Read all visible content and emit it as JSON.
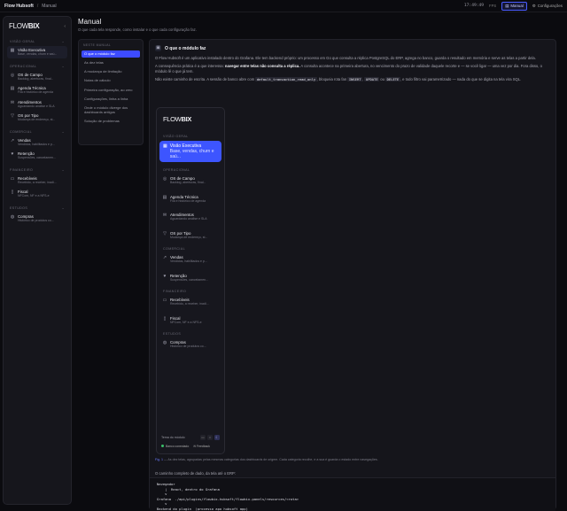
{
  "topbar": {
    "brand": "Flow Hubsoft",
    "breadcrumb": "Manual",
    "clock": "17:49:49",
    "fps": "FPS",
    "manual_label": "Manual",
    "config_label": "Configurações"
  },
  "sidebar": {
    "logo_flow": "FLOW",
    "logo_bix": "BIX",
    "sections": [
      {
        "title": "VISÃO GERAL",
        "items": [
          {
            "label": "Visão Executiva",
            "sub": "Base, vendas, churn e saú..."
          }
        ]
      },
      {
        "title": "OPERACIONAL",
        "items": [
          {
            "label": "OS de Campo",
            "sub": "Backlog, aberturas, final..."
          },
          {
            "label": "Agenda Técnica",
            "sub": "Fila e histórico de agenda"
          },
          {
            "label": "Atendimentos",
            "sub": "Aguardando análise e SLA"
          },
          {
            "label": "OS por Tipo",
            "sub": "Mudança de endereço, st..."
          }
        ]
      },
      {
        "title": "COMERCIAL",
        "items": [
          {
            "label": "Vendas",
            "sub": "Vendidos, habilitados e p..."
          },
          {
            "label": "Retenção",
            "sub": "Suspensões, cancelamen..."
          }
        ]
      },
      {
        "title": "FINANCEIRO",
        "items": [
          {
            "label": "Recebíveis",
            "sub": "Recebido, a receber, inadi..."
          },
          {
            "label": "Fiscal",
            "sub": "NFCom, NF e a NFS-e"
          }
        ]
      },
      {
        "title": "ESTUDOS",
        "items": [
          {
            "label": "Compras",
            "sub": "Histórico de produtos co..."
          }
        ]
      }
    ]
  },
  "page": {
    "title": "Manual",
    "subtitle": "O que cada tela responde, como instalar e o que cada configuração faz."
  },
  "toc": {
    "title": "NESTE MANUAL",
    "items": [
      "O que o módulo faz",
      "As dez telas",
      "A mudança de limitação",
      "Notas de cálculo",
      "Primeira configuração, ao zero",
      "Configurações, linha a linha",
      "Onde o módulo diverge dos dashboards antigos",
      "Solução de problemas"
    ]
  },
  "content": {
    "section_title": "O que o módulo faz",
    "p1": "O Flow Hubsoft é um aplicativo instalado dentro do Grafana. Ele tem backend próprio: um processo em Go que consulta a réplica PostgreSQL do ERP, agrega no banco, guarda o resultado em memória e serve as telas a partir dela.",
    "p2_a": "A consequência prática é a que interessa: ",
    "p2_b": "navegar entre telas não consulta a réplica.",
    "p2_c": " A consulta acontece na primeira abertura, no vencimento do prazo de validade daquele recorte e — se você ligar — uma vez por dia. Fora disso, o módulo lê o que já tem.",
    "p3_a": "Não existe caminho de escrita. A sessão de banco abre com ",
    "p3_code1": "default_transaction_read_only",
    "p3_b": ", bloqueia rota fan ",
    "p3_code2": "INSERT",
    "p3_c": ", ",
    "p3_code3": "UPDATE",
    "p3_d": " ou ",
    "p3_code4": "DELETE",
    "p3_e": ", e todo filtro vai parametrizado — nada do que se digita na tela vira SQL.",
    "caption_fig": "Fig. 1",
    "caption": " — As dez telas, agrupadas pelas mesmas categorias dos dashboards de origem. Cada categoria recolhe, e a sua é guarda o estado entre navegações.",
    "code_intro": "O caminho completo de dado, da tela até o ERP:",
    "code": "Navegador\n    |  React, dentro do Grafana\n    v\nGrafana  ./api/plugins/flowbix-hubsoft/flowbix-panels/resources/<rota>\n    v\nBackend do plugin  (processo apo hubsoft app)"
  },
  "shot": {
    "logo_flow": "FLOW",
    "logo_bix": "BIX",
    "sections": [
      {
        "title": "VISÃO GERAL",
        "items": [
          {
            "label": "Visão Executiva",
            "sub": "Base, vendas, churn e saú..."
          }
        ]
      },
      {
        "title": "OPERACIONAL",
        "items": [
          {
            "label": "OS de Campo",
            "sub": "Backlog, aberturas, final..."
          },
          {
            "label": "Agenda Técnica",
            "sub": "Fila e histórico de agenda"
          },
          {
            "label": "Atendimentos",
            "sub": "Aguardando análise e SLA"
          },
          {
            "label": "OS por Tipo",
            "sub": "Mudança de endereço, st..."
          }
        ]
      },
      {
        "title": "COMERCIAL",
        "items": [
          {
            "label": "Vendas",
            "sub": "Vendidos, habilitados e p..."
          },
          {
            "label": "Retenção",
            "sub": "Suspensões, cancelamen..."
          }
        ]
      },
      {
        "title": "FINANCEIRO",
        "items": [
          {
            "label": "Recebíveis",
            "sub": "Recebido, a receber, inadi..."
          },
          {
            "label": "Fiscal",
            "sub": "NFCom, NF e a NFS-e"
          }
        ]
      },
      {
        "title": "ESTUDOS",
        "items": [
          {
            "label": "Compras",
            "sub": "Histórico de produtos co..."
          }
        ]
      }
    ],
    "theme_label": "Tema do módulo",
    "status": "Banco conectado",
    "feedback": "Feedback"
  }
}
